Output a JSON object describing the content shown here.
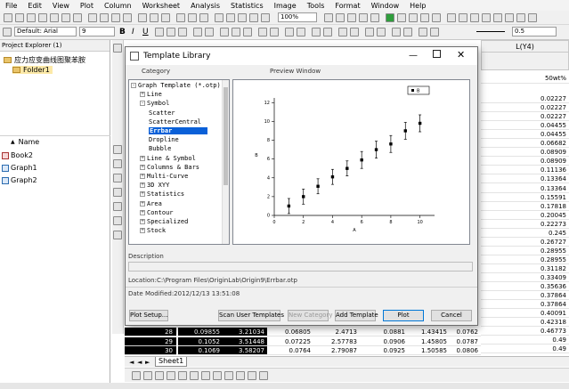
{
  "menubar": {
    "items": [
      "File",
      "Edit",
      "View",
      "Plot",
      "Column",
      "Worksheet",
      "Analysis",
      "Statistics",
      "Image",
      "Tools",
      "Format",
      "Window",
      "Help"
    ]
  },
  "toolbar": {
    "zoom": "100%",
    "font_name": "Default: Arial",
    "font_size": "9",
    "bold": "B",
    "italic": "I",
    "underline": "U",
    "line_width": "0.5"
  },
  "project_explorer": {
    "title": "Project Explorer (1)",
    "root": "应力应变曲线图聚苯胺",
    "folder": "Folder1",
    "name_header": "Name",
    "items": [
      "Book2",
      "Graph1",
      "Graph2"
    ]
  },
  "worksheet": {
    "right_col_header": "L(Y4)",
    "right_col_units": "50wt%",
    "right_col_values": [
      "0.02227",
      "0.02227",
      "0.02227",
      "0.04455",
      "0.04455",
      "0.06682",
      "0.08909",
      "0.08909",
      "0.11136",
      "0.13364",
      "0.13364",
      "0.15591",
      "0.17818",
      "0.20045",
      "0.22273",
      "0.245",
      "0.26727",
      "0.28955",
      "0.28955",
      "0.31182",
      "0.33409",
      "0.35636",
      "0.37864",
      "0.37864",
      "0.40091",
      "0.42318",
      "0.46773",
      "0.49",
      "0.49"
    ],
    "bottom_rows": [
      {
        "n": "28",
        "c1": "0.09855",
        "c2": "3.21034",
        "c3": "0.06805",
        "c4": "2.4713",
        "c5": "0.0881",
        "c6": "1.43415",
        "c7": "0.0762"
      },
      {
        "n": "29",
        "c1": "0.1052",
        "c2": "3.51448",
        "c3": "0.07225",
        "c4": "2.57783",
        "c5": "0.0906",
        "c6": "1.45805",
        "c7": "0.0787"
      },
      {
        "n": "30",
        "c1": "0.1069",
        "c2": "3.58207",
        "c3": "0.0764",
        "c4": "2.79087",
        "c5": "0.0925",
        "c6": "1.50585",
        "c7": "0.0806"
      }
    ],
    "sheet_tab": "Sheet1"
  },
  "dialog": {
    "title": "Template Library",
    "category_label": "Category",
    "preview_label": "Preview Window",
    "categories": [
      {
        "label": "Graph Template (*.otp)",
        "level": 0,
        "sign": "-"
      },
      {
        "label": "Line",
        "level": 1,
        "sign": "+"
      },
      {
        "label": "Symbol",
        "level": 1,
        "sign": "-"
      },
      {
        "label": "Scatter",
        "level": 2,
        "sign": ""
      },
      {
        "label": "ScatterCentral",
        "level": 2,
        "sign": ""
      },
      {
        "label": "Errbar",
        "level": 2,
        "sign": "",
        "selected": true
      },
      {
        "label": "Dropline",
        "level": 2,
        "sign": ""
      },
      {
        "label": "Bubble",
        "level": 2,
        "sign": ""
      },
      {
        "label": "Line & Symbol",
        "level": 1,
        "sign": "+"
      },
      {
        "label": "Columns & Bars",
        "level": 1,
        "sign": "+"
      },
      {
        "label": "Multi-Curve",
        "level": 1,
        "sign": "+"
      },
      {
        "label": "3D XYY",
        "level": 1,
        "sign": "+"
      },
      {
        "label": "Statistics",
        "level": 1,
        "sign": "+"
      },
      {
        "label": "Area",
        "level": 1,
        "sign": "+"
      },
      {
        "label": "Contour",
        "level": 1,
        "sign": "+"
      },
      {
        "label": "Specialized",
        "level": 1,
        "sign": "+"
      },
      {
        "label": "Stock",
        "level": 1,
        "sign": "+"
      }
    ],
    "preview": {
      "legend": "B",
      "xlabel": "A",
      "ylabel": "B",
      "xticks": [
        "0",
        "2",
        "4",
        "6",
        "8",
        "10"
      ],
      "yticks": [
        "0",
        "2",
        "4",
        "6",
        "8",
        "10",
        "12"
      ],
      "points": [
        {
          "x": 1,
          "y": 1.0,
          "e": 0.8
        },
        {
          "x": 2,
          "y": 2.0,
          "e": 0.8
        },
        {
          "x": 3,
          "y": 3.1,
          "e": 0.8
        },
        {
          "x": 4,
          "y": 4.1,
          "e": 0.8
        },
        {
          "x": 5,
          "y": 5.0,
          "e": 0.8
        },
        {
          "x": 6,
          "y": 5.9,
          "e": 0.9
        },
        {
          "x": 7,
          "y": 7.0,
          "e": 0.9
        },
        {
          "x": 8,
          "y": 7.6,
          "e": 0.9
        },
        {
          "x": 9,
          "y": 9.0,
          "e": 0.9
        },
        {
          "x": 10,
          "y": 9.8,
          "e": 0.9
        }
      ]
    },
    "description_label": "Description",
    "location": "Location:C:\\Program Files\\OriginLab\\Origin9\\Errbar.otp",
    "date_modified": "Date Modified:2012/12/13 13:51:08",
    "buttons": {
      "plot_setup": "Plot Setup...",
      "scan": "Scan User Templates",
      "new_category": "New Category",
      "add_template": "Add Template",
      "plot": "Plot",
      "cancel": "Cancel"
    }
  },
  "colors": {
    "selection": "#0a60d8",
    "accent": "#0078d7"
  }
}
